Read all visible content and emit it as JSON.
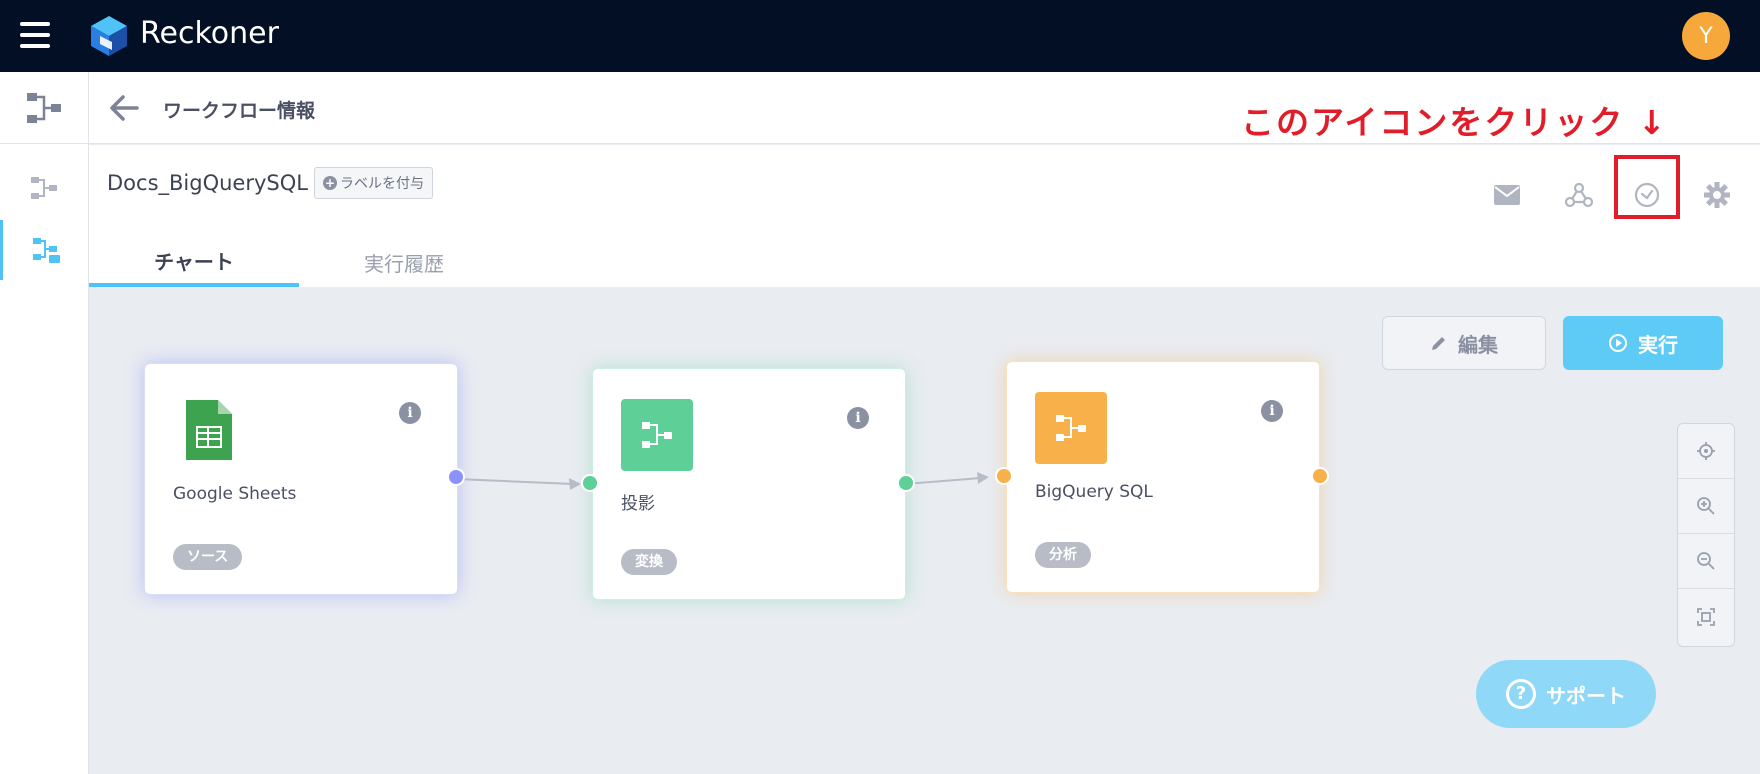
{
  "app": {
    "brand": "Reckoner",
    "avatar_initial": "Y"
  },
  "header": {
    "title": "ワークフロー情報"
  },
  "annotation": {
    "text": "このアイコンをクリック ↓",
    "color": "#e11d2a"
  },
  "workflow": {
    "name": "Docs_BigQuerySQL",
    "label_button": "ラベルを付与"
  },
  "toolbar": {
    "icons": [
      "mail-icon",
      "webhook-icon",
      "schedule-clock-icon",
      "settings-gear-icon"
    ]
  },
  "tabs": [
    {
      "label": "チャート",
      "active": true
    },
    {
      "label": "実行履歴",
      "active": false
    }
  ],
  "actions": {
    "edit_label": "編集",
    "run_label": "実行",
    "support_label": "サポート"
  },
  "nodes": [
    {
      "title": "Google Sheets",
      "badge": "ソース",
      "icon": "google-sheets-icon",
      "color": "#8a93fb"
    },
    {
      "title": "投影",
      "badge": "変換",
      "icon": "transform-icon",
      "color": "#5ecf97"
    },
    {
      "title": "BigQuery SQL",
      "badge": "分析",
      "icon": "analysis-icon",
      "color": "#f7b04a"
    }
  ],
  "zoom_controls": [
    "center-icon",
    "zoom-in-icon",
    "zoom-out-icon",
    "fit-screen-icon"
  ],
  "colors": {
    "topbar": "#030f24",
    "accent": "#4fc3f7",
    "run": "#5ecbf7"
  }
}
